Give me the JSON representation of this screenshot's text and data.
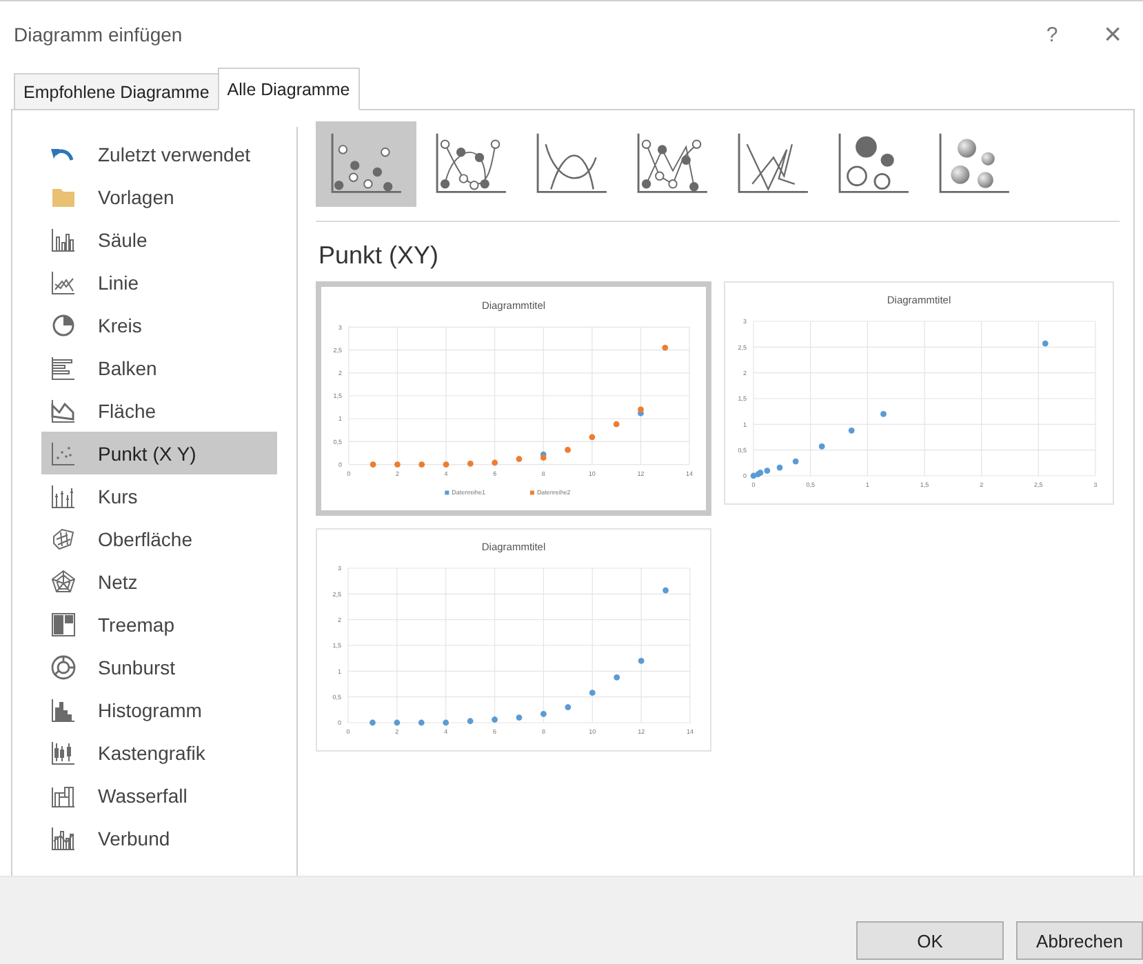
{
  "window": {
    "title": "Diagramm einfügen",
    "help": "?",
    "close": "×"
  },
  "tabs": [
    {
      "label": "Empfohlene Diagramme",
      "selected": false
    },
    {
      "label": "Alle Diagramme",
      "selected": true
    }
  ],
  "sidebar": {
    "items": [
      {
        "kind": "recent",
        "label": "Zuletzt verwendet",
        "selected": false
      },
      {
        "kind": "templates",
        "label": "Vorlagen",
        "selected": false
      },
      {
        "kind": "column",
        "label": "Säule",
        "selected": false
      },
      {
        "kind": "line",
        "label": "Linie",
        "selected": false
      },
      {
        "kind": "pie",
        "label": "Kreis",
        "selected": false
      },
      {
        "kind": "bar",
        "label": "Balken",
        "selected": false
      },
      {
        "kind": "area",
        "label": "Fläche",
        "selected": false
      },
      {
        "kind": "scatter",
        "label": "Punkt (X Y)",
        "selected": true
      },
      {
        "kind": "stock",
        "label": "Kurs",
        "selected": false
      },
      {
        "kind": "surface",
        "label": "Oberfläche",
        "selected": false
      },
      {
        "kind": "radar",
        "label": "Netz",
        "selected": false
      },
      {
        "kind": "treemap",
        "label": "Treemap",
        "selected": false
      },
      {
        "kind": "sunburst",
        "label": "Sunburst",
        "selected": false
      },
      {
        "kind": "histogram",
        "label": "Histogramm",
        "selected": false
      },
      {
        "kind": "boxplot",
        "label": "Kastengrafik",
        "selected": false
      },
      {
        "kind": "waterfall",
        "label": "Wasserfall",
        "selected": false
      },
      {
        "kind": "combo",
        "label": "Verbund",
        "selected": false
      }
    ]
  },
  "subtypes": [
    {
      "kind": "markers",
      "selected": true
    },
    {
      "kind": "smooth-markers",
      "selected": false
    },
    {
      "kind": "smooth",
      "selected": false
    },
    {
      "kind": "straight-markers",
      "selected": false
    },
    {
      "kind": "straight",
      "selected": false
    },
    {
      "kind": "bubble",
      "selected": false
    },
    {
      "kind": "bubble-3d",
      "selected": false
    }
  ],
  "heading": "Punkt (XY)",
  "previews": [
    {
      "selected": true,
      "chart_data": {
        "type": "scatter",
        "title": "Diagrammtitel",
        "x": [
          1,
          2,
          3,
          4,
          5,
          6,
          7,
          8,
          9,
          10,
          11,
          12,
          13
        ],
        "grid": true,
        "legend": "bottom",
        "series": [
          {
            "name": "Datenreihe1",
            "color": "#5b9bd5",
            "values": [
              null,
              null,
              null,
              null,
              null,
              null,
              null,
              0.22,
              null,
              null,
              null,
              1.12,
              null
            ]
          },
          {
            "name": "Datenreihe2",
            "color": "#ed7d31",
            "values": [
              0,
              0,
              0,
              0,
              0.02,
              0.04,
              0.12,
              0.15,
              0.32,
              0.6,
              0.88,
              1.2,
              2.55
            ]
          }
        ],
        "xlim": [
          0,
          14
        ],
        "ylim": [
          0,
          3
        ],
        "xticks": [
          0,
          2,
          4,
          6,
          8,
          10,
          12,
          14
        ],
        "yticks": [
          0,
          {
            "value": 0.5,
            "label": "0,5"
          },
          1,
          {
            "value": 1.5,
            "label": "1,5"
          },
          2,
          {
            "value": 2.5,
            "label": "2,5"
          },
          3
        ]
      }
    },
    {
      "selected": false,
      "chart_data": {
        "type": "scatter",
        "title": "Diagrammtitel",
        "x": [
          0,
          0.04,
          0.06,
          0.12,
          0.23,
          0.37,
          0.6,
          0.86,
          1.14,
          2.56
        ],
        "grid": true,
        "series": [
          {
            "color": "#5b9bd5",
            "values": [
              0,
              0.03,
              0.06,
              0.1,
              0.16,
              0.28,
              0.57,
              0.88,
              1.2,
              2.57
            ]
          }
        ],
        "xlim": [
          0,
          3
        ],
        "ylim": [
          0,
          3
        ],
        "xticks": [
          0,
          {
            "value": 0.5,
            "label": "0,5"
          },
          1,
          {
            "value": 1.5,
            "label": "1,5"
          },
          2,
          {
            "value": 2.5,
            "label": "2,5"
          },
          3
        ],
        "yticks": [
          0,
          {
            "value": 0.5,
            "label": "0,5"
          },
          1,
          {
            "value": 1.5,
            "label": "1,5"
          },
          2,
          {
            "value": 2.5,
            "label": "2,5"
          },
          3
        ]
      }
    },
    {
      "selected": false,
      "chart_data": {
        "type": "scatter",
        "title": "Diagrammtitel",
        "x": [
          1,
          2,
          3,
          4,
          5,
          6,
          7,
          8,
          9,
          10,
          11,
          12,
          13
        ],
        "grid": true,
        "series": [
          {
            "color": "#5b9bd5",
            "values": [
              0,
              0,
              0,
              0,
              0.03,
              0.06,
              0.1,
              0.17,
              0.3,
              0.58,
              0.88,
              1.2,
              2.57
            ]
          }
        ],
        "xlim": [
          0,
          14
        ],
        "ylim": [
          0,
          3
        ],
        "xticks": [
          0,
          2,
          4,
          6,
          8,
          10,
          12,
          14
        ],
        "yticks": [
          0,
          {
            "value": 0.5,
            "label": "0,5"
          },
          1,
          {
            "value": 1.5,
            "label": "1,5"
          },
          2,
          {
            "value": 2.5,
            "label": "2,5"
          },
          3
        ]
      }
    }
  ],
  "buttons": [
    "OK",
    "Abbrechen"
  ]
}
